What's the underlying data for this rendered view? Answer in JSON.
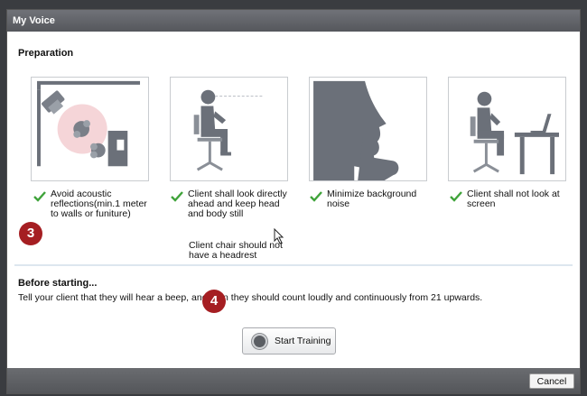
{
  "window": {
    "title": "My Voice"
  },
  "preparation": {
    "title": "Preparation",
    "items": [
      {
        "text": "Avoid acoustic reflections(min.1 meter to walls or funiture)",
        "icon": "room-layout-illustration"
      },
      {
        "text": "Client shall look directly ahead and keep head and body still",
        "icon": "seated-client-looking-ahead-illustration"
      },
      {
        "text": "Minimize background noise",
        "icon": "silence-gesture-illustration"
      },
      {
        "text": "Client shall not look at screen",
        "icon": "client-away-from-screen-illustration"
      }
    ],
    "note": "Client chair should not have a headrest"
  },
  "before": {
    "title": "Before starting...",
    "text": "Tell your client that they will hear a beep, and then they should count loudly and continuously from 21 upwards."
  },
  "start_button": {
    "label": "Start Training"
  },
  "footer": {
    "cancel_label": "Cancel"
  },
  "markers": [
    "3",
    "4"
  ],
  "colors": {
    "check": "#3fa33a",
    "marker": "#a51e22",
    "figure": "#6b7079",
    "titlebar": "#5f6166"
  }
}
